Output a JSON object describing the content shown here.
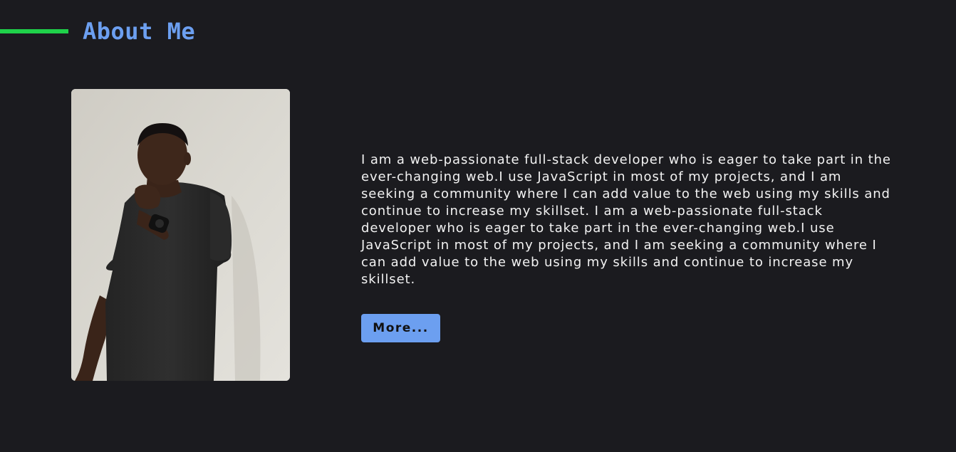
{
  "section": {
    "title": "About Me"
  },
  "about": {
    "bio": "I am a web-passionate full-stack developer who is eager to take part in the ever-changing web.I use JavaScript in most of my projects, and I am seeking a community where I can add value to the web using my skills and continue to increase my skillset. I am a web-passionate full-stack developer who is eager to take part in the ever-changing web.I use JavaScript in most of my projects, and I am seeking a community where I can add value to the web using my skills and continue to increase my skillset.",
    "more_button_label": "More..."
  },
  "theme": {
    "background": "#1b1b1f",
    "accent_line": "#1fd14a",
    "title_color": "#6c9ff0",
    "button_color": "#6c9ff0",
    "text_color": "#f2f2f2"
  }
}
